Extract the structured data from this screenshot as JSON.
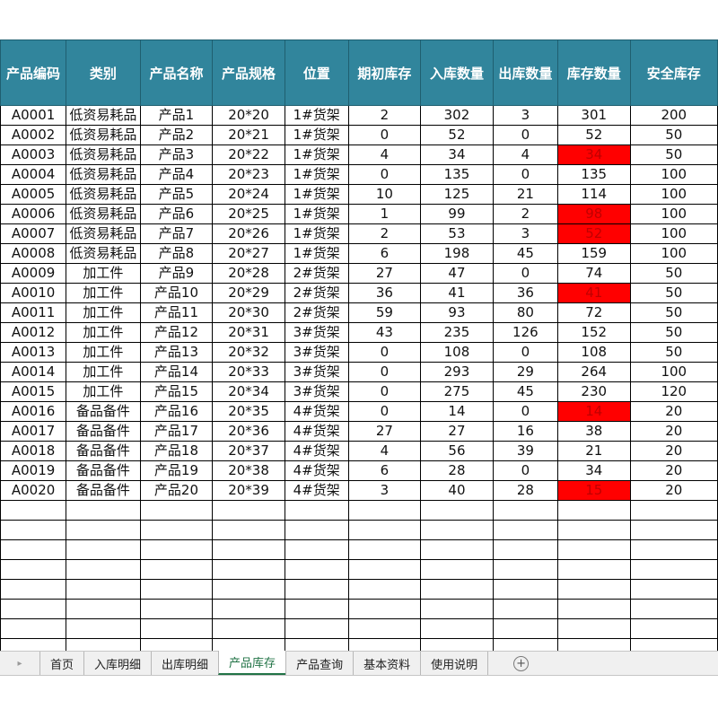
{
  "sheet": {
    "headers": [
      "产品编码",
      "类别",
      "产品名称",
      "产品规格",
      "位置",
      "期初库存",
      "入库数量",
      "出库数量",
      "库存数量",
      "安全库存"
    ],
    "rows": [
      [
        "A0001",
        "低资易耗品",
        "产品1",
        "20*20",
        "1#货架",
        "2",
        "302",
        "3",
        "301",
        "200"
      ],
      [
        "A0002",
        "低资易耗品",
        "产品2",
        "20*21",
        "1#货架",
        "0",
        "52",
        "0",
        "52",
        "50"
      ],
      [
        "A0003",
        "低资易耗品",
        "产品3",
        "20*22",
        "1#货架",
        "4",
        "34",
        "4",
        "34",
        "50"
      ],
      [
        "A0004",
        "低资易耗品",
        "产品4",
        "20*23",
        "1#货架",
        "0",
        "135",
        "0",
        "135",
        "100"
      ],
      [
        "A0005",
        "低资易耗品",
        "产品5",
        "20*24",
        "1#货架",
        "10",
        "125",
        "21",
        "114",
        "100"
      ],
      [
        "A0006",
        "低资易耗品",
        "产品6",
        "20*25",
        "1#货架",
        "1",
        "99",
        "2",
        "98",
        "100"
      ],
      [
        "A0007",
        "低资易耗品",
        "产品7",
        "20*26",
        "1#货架",
        "2",
        "53",
        "3",
        "52",
        "100"
      ],
      [
        "A0008",
        "低资易耗品",
        "产品8",
        "20*27",
        "1#货架",
        "6",
        "198",
        "45",
        "159",
        "100"
      ],
      [
        "A0009",
        "加工件",
        "产品9",
        "20*28",
        "2#货架",
        "27",
        "47",
        "0",
        "74",
        "50"
      ],
      [
        "A0010",
        "加工件",
        "产品10",
        "20*29",
        "2#货架",
        "36",
        "41",
        "36",
        "41",
        "50"
      ],
      [
        "A0011",
        "加工件",
        "产品11",
        "20*30",
        "2#货架",
        "59",
        "93",
        "80",
        "72",
        "50"
      ],
      [
        "A0012",
        "加工件",
        "产品12",
        "20*31",
        "3#货架",
        "43",
        "235",
        "126",
        "152",
        "50"
      ],
      [
        "A0013",
        "加工件",
        "产品13",
        "20*32",
        "3#货架",
        "0",
        "108",
        "0",
        "108",
        "50"
      ],
      [
        "A0014",
        "加工件",
        "产品14",
        "20*33",
        "3#货架",
        "0",
        "293",
        "29",
        "264",
        "100"
      ],
      [
        "A0015",
        "加工件",
        "产品15",
        "20*34",
        "3#货架",
        "0",
        "275",
        "45",
        "230",
        "120"
      ],
      [
        "A0016",
        "备品备件",
        "产品16",
        "20*35",
        "4#货架",
        "0",
        "14",
        "0",
        "14",
        "20"
      ],
      [
        "A0017",
        "备品备件",
        "产品17",
        "20*36",
        "4#货架",
        "27",
        "27",
        "16",
        "38",
        "20"
      ],
      [
        "A0018",
        "备品备件",
        "产品18",
        "20*37",
        "4#货架",
        "4",
        "56",
        "39",
        "21",
        "20"
      ],
      [
        "A0019",
        "备品备件",
        "产品19",
        "20*38",
        "4#货架",
        "6",
        "28",
        "0",
        "34",
        "20"
      ],
      [
        "A0020",
        "备品备件",
        "产品20",
        "20*39",
        "4#货架",
        "3",
        "40",
        "28",
        "15",
        "20"
      ]
    ],
    "low_stock_rows": [
      2,
      5,
      6,
      9,
      15,
      19
    ],
    "empty_rows": 8,
    "low_stock_color": "#ff0000",
    "header_color": "#31859c"
  },
  "tabs": {
    "items": [
      "首页",
      "入库明细",
      "出库明细",
      "产品库存",
      "产品查询",
      "基本资料",
      "使用说明"
    ],
    "active": "产品库存",
    "accent_color": "#217346"
  },
  "icons": {
    "nav": "nav-arrow-icon",
    "add": "add-sheet-icon"
  }
}
